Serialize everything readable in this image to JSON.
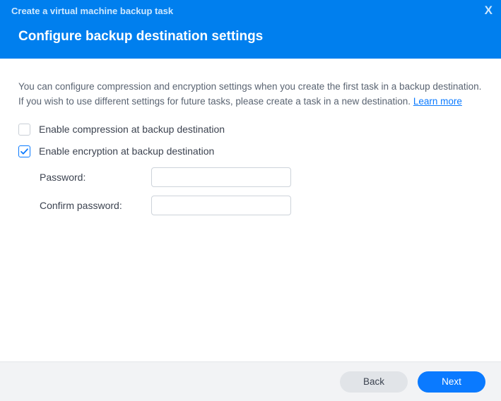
{
  "header": {
    "title": "Create a virtual machine backup task",
    "subtitle": "Configure backup destination settings",
    "close": "X"
  },
  "description": {
    "text_part1": "You can configure compression and encryption settings when you create the first task in a backup destination. If you wish to use different settings for future tasks, please create a task in a new destination. ",
    "learn_more": "Learn more"
  },
  "options": {
    "compression": {
      "label": "Enable compression at backup destination",
      "checked": false
    },
    "encryption": {
      "label": "Enable encryption at backup destination",
      "checked": true
    }
  },
  "fields": {
    "password": {
      "label": "Password:",
      "value": ""
    },
    "confirm_password": {
      "label": "Confirm password:",
      "value": ""
    }
  },
  "footer": {
    "back": "Back",
    "next": "Next"
  }
}
